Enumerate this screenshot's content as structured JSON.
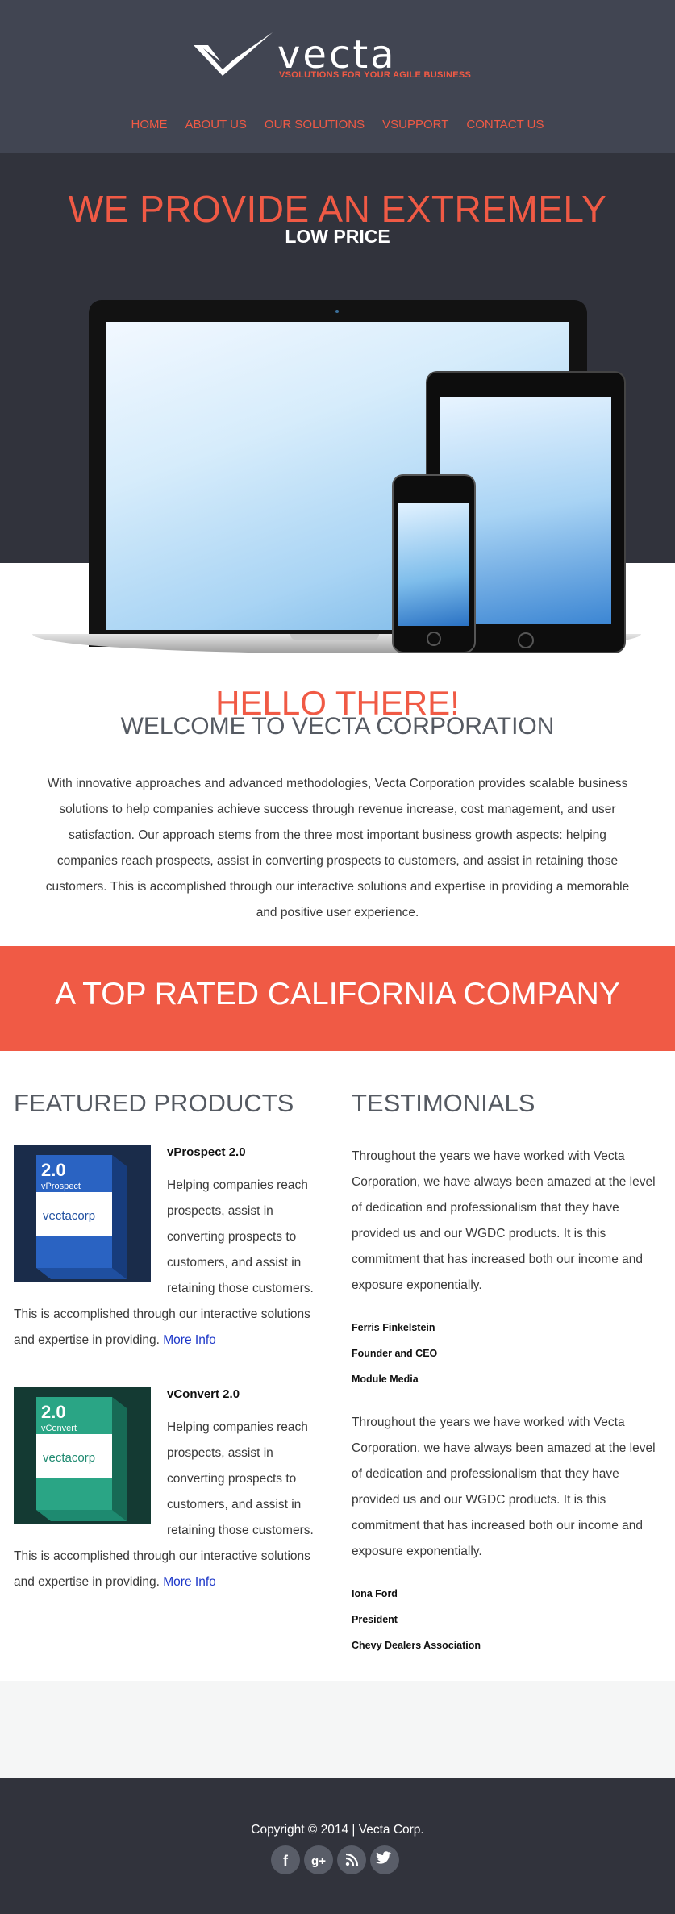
{
  "header": {
    "logo_word": "vecta",
    "tagline": "VSOLUTIONS FOR YOUR AGILE BUSINESS",
    "nav": [
      "HOME",
      "ABOUT US",
      "OUR SOLUTIONS",
      "VSUPPORT",
      "CONTACT US"
    ]
  },
  "hero": {
    "title": "WE PROVIDE AN EXTREMELY",
    "subtitle": "LOW PRICE"
  },
  "welcome": {
    "hello": "HELLO THERE!",
    "title": "WELCOME TO VECTA CORPORATION",
    "lines": [
      "With innovative approaches and advanced methodologies, Vecta Corporation provides scalable business",
      "solutions to help companies achieve success through revenue increase, cost management, and user",
      "satisfaction. Our approach stems from the three most important business growth aspects: helping",
      "companies reach prospects, assist in converting prospects to customers, and assist in retaining those",
      "customers. This is accomplished through our interactive solutions and expertise in providing a memorable",
      "and positive user experience."
    ]
  },
  "banner": {
    "text": "A TOP RATED CALIFORNIA COMPANY"
  },
  "products": {
    "title": "FEATURED PRODUCTS",
    "items": [
      {
        "name": "vProspect 2.0",
        "box_version": "2.0",
        "box_product": "vProspect",
        "box_brand": "vectacorp",
        "indented_lines": [
          "Helping companies reach",
          "prospects, assist in",
          "converting prospects to",
          "customers, and assist in",
          "retaining those customers."
        ],
        "lines": [
          "This is accomplished through our interactive solutions"
        ],
        "last_line": "and expertise in providing.",
        "link": "More Info",
        "color": "#1f4fa0"
      },
      {
        "name": "vConvert 2.0",
        "box_version": "2.0",
        "box_product": "vConvert",
        "box_brand": "vectacorp",
        "indented_lines": [
          "Helping companies reach",
          "prospects, assist in",
          "converting prospects to",
          "customers, and assist in",
          "retaining those customers."
        ],
        "lines": [
          "This is accomplished through our interactive solutions"
        ],
        "last_line": "and expertise in providing.",
        "link": "More Info",
        "color": "#1e8a70"
      }
    ]
  },
  "testimonials": {
    "title": "TESTIMONIALS",
    "items": [
      {
        "lines": [
          "Throughout the years we have worked with Vecta",
          "Corporation, we have always been amazed at the level",
          "of dedication and professionalism that they have",
          "provided us and our WGDC products. It is this",
          "commitment that has increased both our income and",
          "exposure exponentially."
        ],
        "name": "Ferris Finkelstein",
        "role": "Founder and CEO",
        "company": "Module Media"
      },
      {
        "lines": [
          "Throughout the years we have worked with Vecta",
          "Corporation, we have always been amazed at the level",
          "of dedication and professionalism that they have",
          "provided us and our WGDC products. It is this",
          "commitment that has increased both our income and",
          "exposure exponentially."
        ],
        "name": "Iona Ford",
        "role": "President",
        "company": "Chevy Dealers Association"
      }
    ]
  },
  "footer": {
    "copyright": "Copyright © 2014 | Vecta Corp.",
    "social": [
      "facebook-icon",
      "google-plus-icon",
      "rss-icon",
      "twitter-icon"
    ]
  },
  "colors": {
    "accent": "#f05a45",
    "header_bg": "#414552",
    "dark_bg": "#31333c",
    "link": "#1b36c8"
  }
}
